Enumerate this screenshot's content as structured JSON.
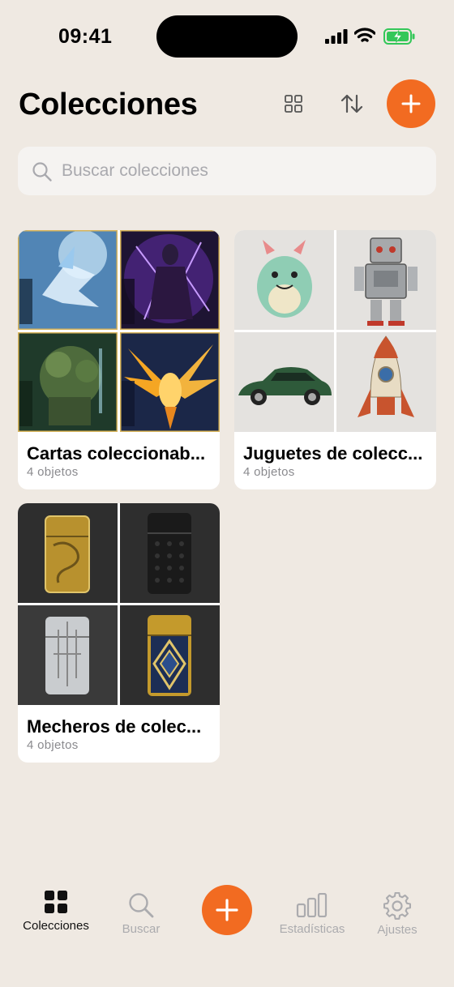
{
  "status_bar": {
    "time": "09:41"
  },
  "header": {
    "title": "Colecciones"
  },
  "search": {
    "placeholder": "Buscar colecciones"
  },
  "collections": [
    {
      "title": "Cartas coleccionab...",
      "count": "4 objetos",
      "thumbs": [
        "ice-dragon-card",
        "dark-sorceress-card",
        "forest-golem-card",
        "phoenix-card"
      ]
    },
    {
      "title": "Juguetes de colecc...",
      "count": "4 objetos",
      "thumbs": [
        "green-monster-toy",
        "tin-robot-toy",
        "green-sports-car-toy",
        "tin-rocket-toy"
      ]
    },
    {
      "title": "Mecheros de colec...",
      "count": "4 objetos",
      "thumbs": [
        "gold-engraved-lighter",
        "black-textured-lighter",
        "silver-deco-lighter",
        "gold-blue-deco-lighter"
      ]
    }
  ],
  "tabbar": {
    "items": [
      {
        "label": "Colecciones",
        "icon": "grid-icon",
        "active": true
      },
      {
        "label": "Buscar",
        "icon": "search-icon"
      },
      {
        "label": "",
        "icon": "plus-icon"
      },
      {
        "label": "Estadísticas",
        "icon": "bar-chart-icon"
      },
      {
        "label": "Ajustes",
        "icon": "gear-icon"
      }
    ]
  },
  "colors": {
    "accent": "#F26B21",
    "background": "#EFE9E2",
    "card": "#FFFFFF",
    "battery": "#34C759"
  }
}
